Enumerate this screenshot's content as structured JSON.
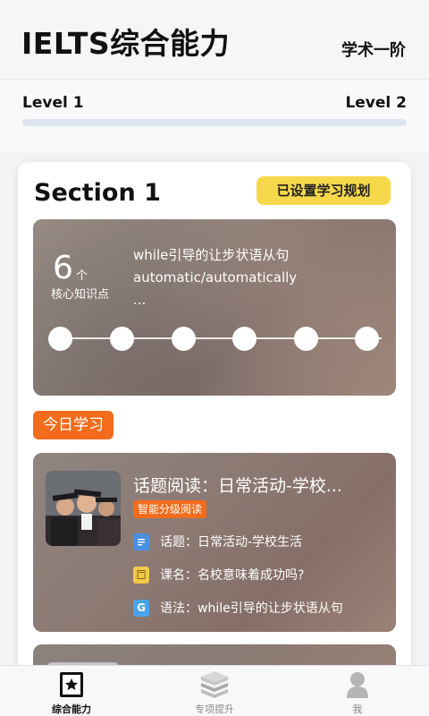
{
  "header": {
    "title": "IELTS综合能力",
    "level_selector": "学术一阶"
  },
  "level_bar": {
    "left_label": "Level 1",
    "right_label": "Level 2",
    "progress": 0
  },
  "section": {
    "title": "Section 1",
    "plan_badge": "已设置学习规划",
    "knowledge": {
      "count": "6",
      "count_unit": "个",
      "count_label": "核心知识点",
      "items": [
        "while引导的让步状语从句",
        "automatic/automatically",
        "..."
      ],
      "steps": 6
    },
    "today_label": "今日学习",
    "lesson": {
      "title": "话题阅读：日常活动-学校...",
      "tag": "智能分级阅读",
      "rows": [
        {
          "icon": "document-icon",
          "text": "话题：日常活动-学校生活"
        },
        {
          "icon": "book-icon",
          "text": "课名：名校意味着成功吗?"
        },
        {
          "icon": "grammar-g-icon",
          "text": "语法：while引导的让步状语从句"
        }
      ]
    }
  },
  "bottom_nav": {
    "items": [
      {
        "label": "综合能力",
        "icon": "star-card-icon",
        "active": true
      },
      {
        "label": "专项提升",
        "icon": "books-stack-icon",
        "active": false
      },
      {
        "label": "我",
        "icon": "person-icon",
        "active": false
      }
    ]
  },
  "colors": {
    "accent_orange": "#f36c1c",
    "badge_yellow": "#f7d84a",
    "progress_track": "#dde5f1"
  }
}
